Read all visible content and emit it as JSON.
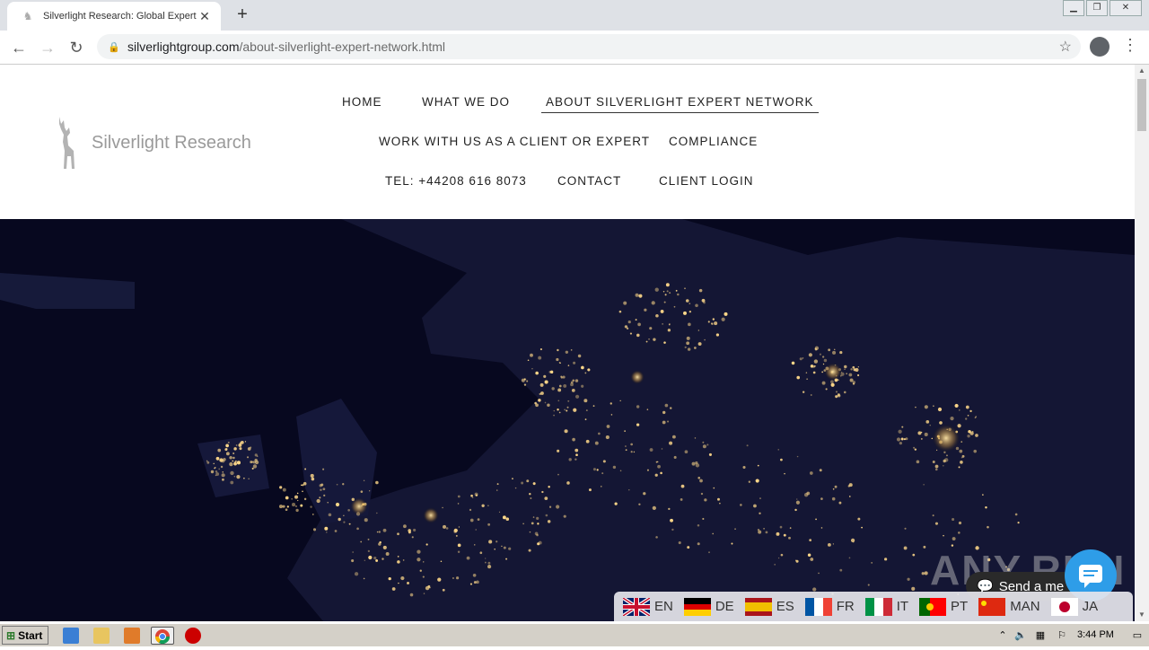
{
  "browser": {
    "tab_title": "Silverlight Research: Global Expert N",
    "new_tab": "+",
    "url_host": "silverlightgroup.com",
    "url_path": "/about-silverlight-expert-network.html"
  },
  "site": {
    "logo_text": "Silverlight Research",
    "nav": {
      "home": "HOME",
      "what_we_do": "WHAT WE DO",
      "about": "ABOUT SILVERLIGHT EXPERT NETWORK",
      "work_with_us": "WORK WITH US AS A CLIENT OR EXPERT",
      "compliance": "COMPLIANCE",
      "tel": "TEL: +44208 616 8073",
      "contact": "CONTACT",
      "client_login": "CLIENT LOGIN"
    }
  },
  "languages": [
    "EN",
    "DE",
    "ES",
    "FR",
    "IT",
    "PT",
    "MAN",
    "JA"
  ],
  "chat": {
    "label": "Send a me"
  },
  "watermark": "ANY.RUN",
  "taskbar": {
    "start": "Start",
    "clock": "3:44 PM"
  },
  "colors": {
    "hero_bg": "#07081f",
    "city_light": "#ffd98a",
    "chat_accent": "#2e9de8"
  }
}
